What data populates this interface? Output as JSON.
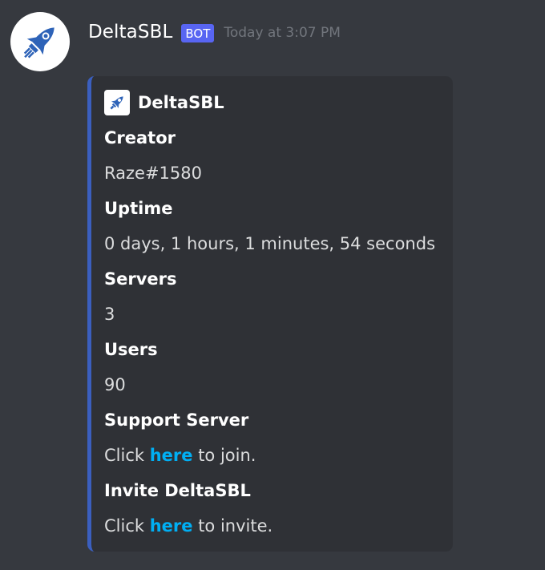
{
  "message": {
    "username": "DeltaSBL",
    "bot_tag": "BOT",
    "timestamp": "Today at 3:07 PM",
    "avatar_icon": "rocket-icon"
  },
  "embed": {
    "accent_color": "#3b5fbf",
    "author": "DeltaSBL",
    "fields": [
      {
        "name": "Creator",
        "value": "Raze#1580"
      },
      {
        "name": "Uptime",
        "value": "0 days, 1 hours, 1 minutes, 54 seconds"
      },
      {
        "name": "Servers",
        "value": "3"
      },
      {
        "name": "Users",
        "value": "90"
      },
      {
        "name": "Support Server",
        "prefix": "Click ",
        "link": "here",
        "suffix": " to join."
      },
      {
        "name": "Invite DeltaSBL",
        "prefix": "Click ",
        "link": "here",
        "suffix": " to invite."
      }
    ]
  },
  "colors": {
    "background": "#36393f",
    "embed_background": "#2f3136",
    "bot_tag": "#5865f2",
    "link": "#00aff4"
  }
}
